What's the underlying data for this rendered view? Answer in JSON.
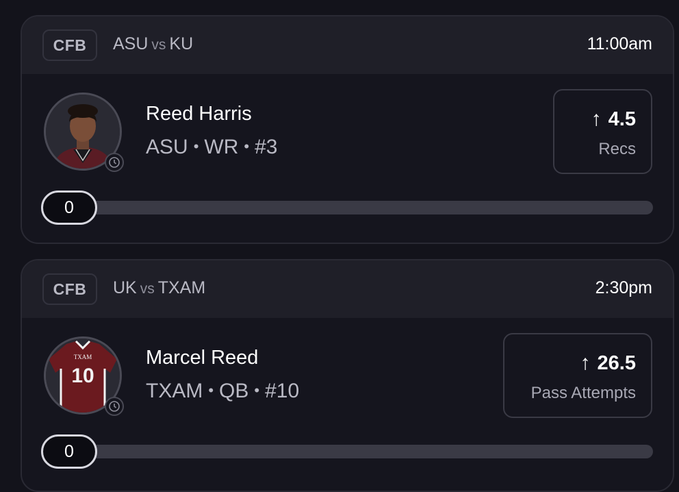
{
  "picks": [
    {
      "league": "CFB",
      "home_team": "ASU",
      "vs_label": "vs",
      "away_team": "KU",
      "time": "11:00am",
      "player": {
        "name": "Reed Harris",
        "team": "ASU",
        "position": "WR",
        "number": "#3"
      },
      "prop": {
        "direction": "over",
        "line": "4.5",
        "stat": "Recs"
      },
      "progress": {
        "current": "0",
        "fraction": 0
      }
    },
    {
      "league": "CFB",
      "home_team": "UK",
      "vs_label": "vs",
      "away_team": "TXAM",
      "time": "2:30pm",
      "player": {
        "name": "Marcel Reed",
        "team": "TXAM",
        "position": "QB",
        "number": "#10"
      },
      "prop": {
        "direction": "over",
        "line": "26.5",
        "stat": "Pass Attempts"
      },
      "progress": {
        "current": "0",
        "fraction": 0
      },
      "jersey": {
        "label": "TXAM",
        "number": "10",
        "color": "#6b1a1f"
      }
    }
  ],
  "separator": "•",
  "colors": {
    "background": "#13131b",
    "card": "#15151e",
    "header": "#1f1f28",
    "muted_text": "#b9b9c4"
  },
  "icons": {
    "direction": "arrow-up-icon",
    "status": "clock-icon"
  }
}
